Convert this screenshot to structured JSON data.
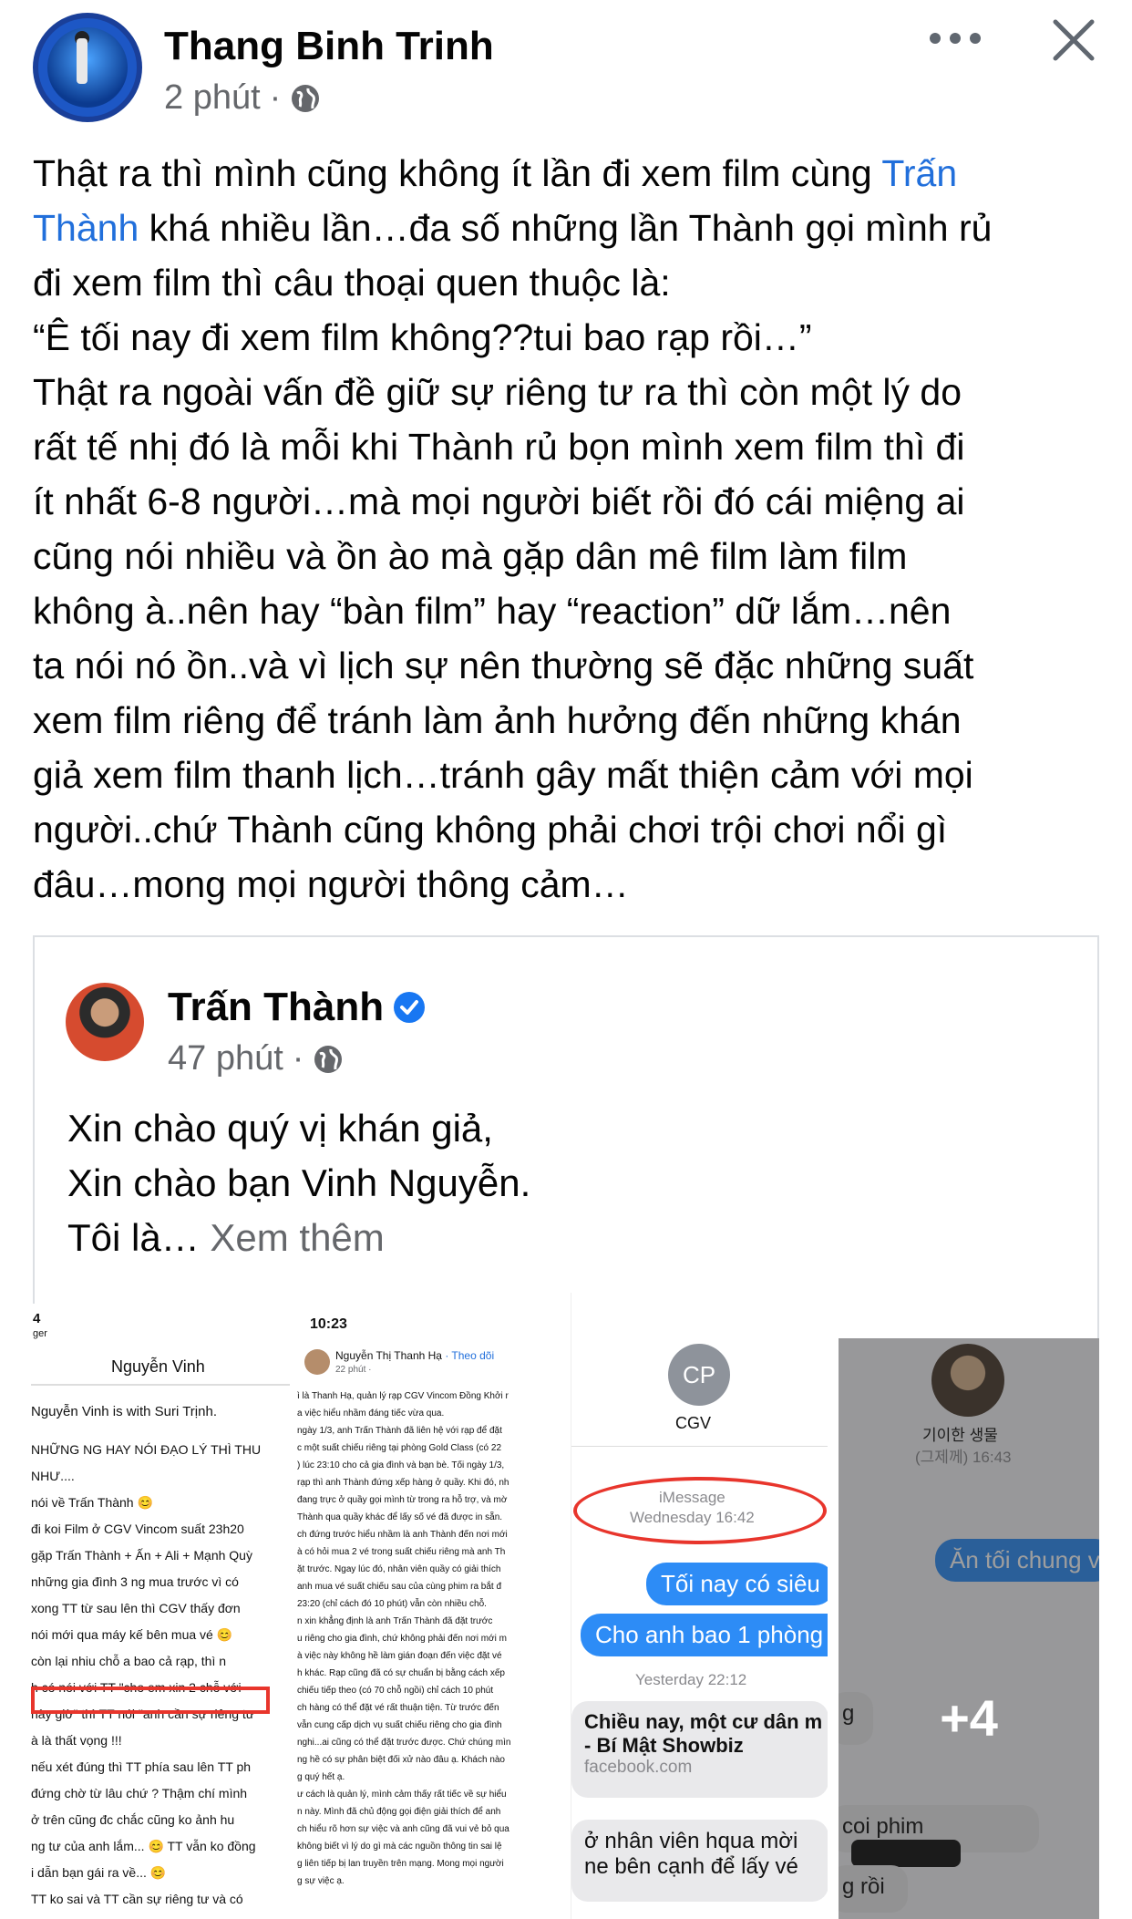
{
  "post": {
    "author": "Thang Binh Trinh",
    "time": "2 phút",
    "separator": "·",
    "text_lines": [
      [
        "Thật ra thì mình cũng không ít lần đi xem film cùng ",
        "Trấn"
      ],
      [
        "Thành",
        " khá nhiều lần…đa số những lần Thành gọi mình rủ"
      ],
      [
        "đi xem film thì câu thoại quen thuộc là:"
      ],
      [
        "“Ê tối nay đi xem film không??tui bao rạp rồi…”"
      ],
      [
        "Thật ra ngoài vấn đề giữ sự riêng tư ra thì còn một lý do"
      ],
      [
        "rất tế nhị đó là mỗi khi Thành rủ bọn mình xem film thì đi"
      ],
      [
        "ít nhất 6-8 người…mà mọi người biết rồi đó cái miệng ai"
      ],
      [
        "cũng nói nhiều và ồn ào mà gặp dân mê film làm film"
      ],
      [
        "không à..nên hay “bàn film” hay “reaction” dữ lắm…nên"
      ],
      [
        "ta nói nó ồn..và vì lịch sự nên thường sẽ đặc những suất"
      ],
      [
        "xem film riêng để tránh làm ảnh hưởng đến những khán"
      ],
      [
        "giả xem film thanh lịch…tránh gây mất thiện cảm với mọi"
      ],
      [
        "người..chứ Thành cũng không phải chơi trội chơi nổi gì"
      ],
      [
        "đâu…mong mọi người thông cảm…"
      ]
    ],
    "line1_a": "Thật ra thì mình cũng không ít lần đi xem film cùng ",
    "line1_mention": "Trấn",
    "line2_mention": "Thành",
    "line2_b": " khá nhiều lần…đa số những lần Thành gọi mình rủ",
    "line3": "đi xem film thì câu thoại quen thuộc là:",
    "line4": "“Ê tối nay đi xem film không??tui bao rạp rồi…”",
    "line5": "Thật ra ngoài vấn đề giữ sự riêng tư ra thì còn một lý do",
    "line6": "rất tế nhị đó là mỗi khi Thành rủ bọn mình xem film thì đi",
    "line7": "ít nhất 6-8 người…mà mọi người biết rồi đó cái miệng ai",
    "line8": "cũng nói nhiều và ồn ào mà gặp dân mê film làm film",
    "line9": "không à..nên hay “bàn film” hay “reaction” dữ lắm…nên",
    "line10": "ta nói nó ồn..và vì lịch sự nên thường sẽ đặc những suất",
    "line11": "xem film riêng để tránh làm ảnh hưởng đến những khán",
    "line12": "giả xem film thanh lịch…tránh gây mất thiện cảm với mọi",
    "line13": "người..chứ Thành cũng không phải chơi trội chơi nổi gì",
    "line14": "đâu…mong mọi người thông cảm…"
  },
  "shared": {
    "author": "Trấn Thành",
    "time": "47 phút",
    "separator": "·",
    "line1": "Xin chào quý vị khán giả,",
    "line2": "Xin chào bạn Vinh Nguyễn.",
    "line3": "Tôi là… ",
    "see_more": "Xem thêm"
  },
  "shot1": {
    "status_left": "4",
    "status_sub": "ger",
    "title": "Nguyễn Vinh",
    "line_author": "Nguyễn Vinh is with Suri Trịnh.",
    "lines": [
      "NHỮNG NG HAY NÓI ĐẠO LÝ THÌ THU",
      "NHƯ....",
      "nói về Trấn Thành 😊",
      "đi koi Film ở CGV Vincom suất 23h20",
      "gặp Trấn Thành + Ấn + Ali + Mạnh Quỳ",
      "những gia đình 3 ng mua trước vì có",
      "xong TT từ sau lên thì CGV thấy đơn",
      "nói mới qua máy kế bên mua vé 😊",
      "còn lại nhiu chỗ a bao cả rạp, thì n",
      "h có nói với TT \"cho em xin 2 chỗ với",
      "này giờ\" thì TT nói \"anh cần sự riêng tư",
      "à là thất vọng !!!",
      "nếu xét đúng thì TT phía sau lên TT ph",
      "đứng chờ từ lâu chứ ? Thậm chí mình",
      "ở trên cũng đc chắc cũng ko ảnh hu",
      "ng tư của anh lắm... 😊 TT vẫn ko đồng",
      "i dẫn bạn gái ra về... 😊",
      "TT ko sai và TT cần sự riêng tư và có"
    ]
  },
  "shot2": {
    "time": "10:23",
    "author": "Nguyễn Thị Thanh Hạ",
    "follow": "· Theo dõi",
    "post_time": "22 phút ·",
    "lines": [
      "ì là Thanh Hạ, quản lý rạp CGV Vincom Đồng Khởi r",
      "a việc hiểu nhầm đáng tiếc vừa qua.",
      "ngày 1/3, anh Trấn Thành đã liên hệ với rạp để đặt",
      "c một suất chiếu riêng tại phòng Gold Class (có 22",
      ") lúc 23:10 cho cả gia đình và bạn bè. Tối ngày 1/3,",
      "rạp thì anh Thành đứng xếp hàng ở quầy. Khi đó, nh",
      "đang trực ở quầy gọi mình từ trong ra hỗ trợ, và mờ",
      "Thành qua quầy khác để lấy số vé đã được in sẵn.",
      "ch đứng trước hiểu nhầm là anh Thành đến nơi mới",
      "à có hỏi mua 2 vé trong suất chiếu riêng mà anh Th",
      "ặt trước. Ngay lúc đó, nhân viên quầy có giải thích",
      "anh mua vé suất chiếu sau của cùng phim ra bắt đ",
      "23:20 (chỉ cách đó 10 phút) vẫn còn nhiều chỗ.",
      "n xin khẳng định là anh Trấn Thành đã đặt trước",
      "u riêng cho gia đình, chứ không phải đến nơi mới m",
      "à việc này không hề làm gián đoạn đến việc đặt vé",
      "h khác. Rạp cũng đã có sự chuẩn bị bằng cách xếp",
      "chiếu tiếp theo (có 70 chỗ ngồi) chỉ cách 10 phút",
      "ch hàng có thể đặt vé rất thuận tiện. Từ trước đến",
      "vẫn cung cấp dịch vụ suất chiếu riêng cho gia đình",
      "nghi...ai cũng có thể đặt trước được. Chứ chúng mìn",
      "ng hề có sự phân biệt đối xử nào đâu ạ. Khách nào",
      "g quý hết ạ.",
      "ư cách là quản lý, mình cảm thấy rất tiếc về sự hiểu",
      "n này. Mình đã chủ động gọi điện giải thích để anh",
      "ch hiểu rõ hơn sự việc và anh cũng đã vui vẻ bỏ qua",
      "không biết vì lý do gì mà các nguồn thông tin sai lệ",
      "g liên tiếp bị lan truyền trên mạng. Mong mọi người",
      "g sự việc ạ."
    ]
  },
  "shot3": {
    "avatar_initials": "CP",
    "contact": "CGV",
    "service": "iMessage",
    "date1": "Wednesday 16:42",
    "bubble1": "Tối nay có siêu",
    "bubble2": "Cho anh bao 1 phòng s",
    "date2": "Yesterday 22:12",
    "link_title_1": "Chiều nay, một cư dân m",
    "link_title_2": "- Bí Mật Showbiz",
    "link_domain": "facebook.com",
    "bubble3_1": "ở nhân viên hqua mời",
    "bubble3_2": "ne bên cạnh để lấy vé"
  },
  "shot4": {
    "contact": "기이한 생물",
    "date": "(그제께) 16:43",
    "bubble1": "Ăn tối chung v",
    "partial_1": "g",
    "partial_2": "coi phim",
    "partial_3": "g rồi",
    "more_count": "+4"
  },
  "colors": {
    "link": "#216fdb",
    "meta": "#65676b",
    "imessage_blue": "#2d8cf6",
    "highlight_red": "#e8352c"
  },
  "icons": [
    "globe-icon",
    "more-icon",
    "close-icon",
    "verified-badge-icon"
  ]
}
